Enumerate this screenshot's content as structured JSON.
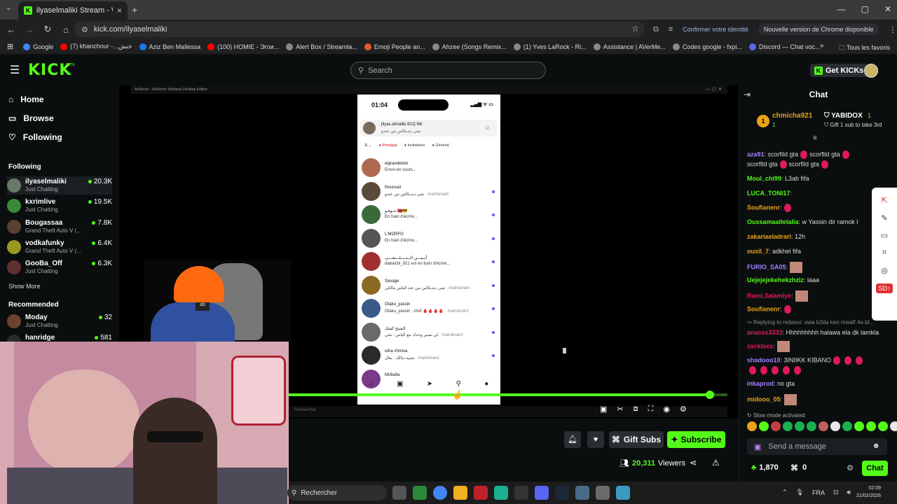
{
  "browser": {
    "tab_title": "ilyaselmaliki Stream - Watch Li...",
    "url": "kick.com/ilyaselmaliki",
    "identity": "Confirmer votre identité",
    "new_version": "Nouvelle version de Chrome disponible",
    "bookmarks": [
      {
        "label": "Google",
        "color": "#4285f4"
      },
      {
        "label": "(7) khanchour -...خنش",
        "color": "#ff0000"
      },
      {
        "label": "Aziz Ben Mallessa",
        "color": "#1877f2"
      },
      {
        "label": "(100) HOMIE - Эгои...",
        "color": "#ff0000"
      },
      {
        "label": "Alert Box / Streamla...",
        "color": "#888888"
      },
      {
        "label": "Emoji People an...",
        "color": "#e8582c"
      },
      {
        "label": "Ahzee (Songs Remix...",
        "color": "#888888"
      },
      {
        "label": "(1) Yves LaRock - Ri...",
        "color": "#888888"
      },
      {
        "label": "Assistance | AVerMe...",
        "color": "#888888"
      },
      {
        "label": "Codes google - fxpi...",
        "color": "#888888"
      },
      {
        "label": "Discord — Chat voc...",
        "color": "#5865f2"
      }
    ],
    "all_bookmarks": "Tous les favoris"
  },
  "kick": {
    "logo": "KICK",
    "beta": "BETA",
    "search_placeholder": "Search",
    "get_kicks": "Get KICKs",
    "brand_color": "#53fc18"
  },
  "sidebar": {
    "nav": [
      {
        "label": "Home",
        "icon": "home-icon"
      },
      {
        "label": "Browse",
        "icon": "browse-icon"
      },
      {
        "label": "Following",
        "icon": "heart-icon"
      }
    ],
    "following_title": "Following",
    "following": [
      {
        "name": "ilyaselmaliki",
        "category": "Just Chatting",
        "viewers": "20.3K",
        "color": "#6a7a6a"
      },
      {
        "name": "kxrimlive",
        "category": "Just Chatting",
        "viewers": "19.5K",
        "color": "#3a8a3a"
      },
      {
        "name": "Bougassaa",
        "category": "Grand Theft Auto V (...",
        "viewers": "7.8K",
        "color": "#5a4030"
      },
      {
        "name": "vodkafunky",
        "category": "Grand Theft Auto V (...",
        "viewers": "6.4K",
        "color": "#9a9a20"
      },
      {
        "name": "GooBa_Off",
        "category": "Just Chatting",
        "viewers": "6.3K",
        "color": "#603030"
      }
    ],
    "show_more": "Show More",
    "recommended_title": "Recommended",
    "recommended": [
      {
        "name": "Moday",
        "category": "Just Chatting",
        "viewers": "32",
        "color": "#704030"
      },
      {
        "name": "hanridge",
        "category": "",
        "viewers": "581",
        "color": "#2a2a2a"
      }
    ]
  },
  "stream": {
    "airserver_title": "AirServer - AirServer Windows Desktop Edition",
    "progress": 0.96,
    "viewers": "20,311",
    "viewers_label": "Viewers",
    "gift_subs": "Gift Subs",
    "subscribe": "Subscribe",
    "inner_search": "Rechercher"
  },
  "phone": {
    "time": "01:04",
    "header_name": "[ilyas.elmaliki.921] Nb'",
    "header_sub": "شي ديدبكاس من عندو",
    "tabs": [
      "Principal",
      "Invitations",
      "Général"
    ],
    "dms": [
      {
        "name": "elgrandetoto",
        "msg": "Envoi en cours...",
        "time": "",
        "color": "#b06a50",
        "dot": false
      },
      {
        "name": "Noussair",
        "msg": "شي ديدبكاس من عندو",
        "time": "· maintenant",
        "color": "#5a4a3a",
        "dot": true
      },
      {
        "name": "خـوفـو 🇲🇦😎",
        "msg": "En train d'écrire...",
        "time": "",
        "color": "#3a6a3a",
        "dot": true
      },
      {
        "name": "L'MORFO",
        "msg": "En train d'écrire...",
        "time": "",
        "color": "#555555",
        "dot": true
      },
      {
        "name": "أيـمـــن الــديـــلـــشـــي",
        "msg": "dabalchi_921 est en train d'écrire...",
        "time": "",
        "color": "#a03030",
        "dot": true
      },
      {
        "name": "Savage",
        "msg": "شي ديدبكاس من عند الياس مالكي",
        "time": "· maintenant",
        "color": "#8a6a20",
        "dot": true
      },
      {
        "name": "Otaku_yassin",
        "msg": "Otaku_yassin : chof 🩸🩸🩸🩸",
        "time": "· maintenant",
        "color": "#3a5a8a",
        "dot": true
      },
      {
        "name": "الشيخ كشك",
        "msg": "لي تسير وحدك مع الياس : شي",
        "time": "· maintenant",
        "color": "#6a6a6a",
        "dot": true
      },
      {
        "name": "ultra chmisa",
        "msg": "شبيه ديالك : بغال",
        "time": "· maintenant",
        "color": "#2a2a2a",
        "dot": true
      },
      {
        "name": "Mc9a9a",
        "msg": "",
        "time": "",
        "color": "#7a3a8a",
        "dot": false
      }
    ]
  },
  "chat": {
    "title": "Chat",
    "gifter_name": "chmicha921",
    "gifter_count": "1",
    "gifter_rank": "1",
    "gifter2_name": "YABIDOX",
    "gifter2_count": "1",
    "gift_note": "Gift 1 sub to take 3rd",
    "messages": [
      {
        "user": "aza91",
        "text": ": scorfild gta",
        "color": "#a080ff",
        "tail": "scorfild gta",
        "line2": "scorfild gta",
        "line2b": "scorfild gta"
      },
      {
        "user": "Moul_chi99",
        "text": ": L3ab fifa",
        "color": "#53fc18"
      },
      {
        "user": "LUCA_TONI17",
        "text": ":",
        "color": "#53fc18"
      },
      {
        "user": "Soufianenr",
        "text": ":",
        "color": "#e8a317"
      },
      {
        "user": "Oussamaaitelalia",
        "text": ": w Yassin dir ramok l",
        "color": "#53fc18"
      },
      {
        "user": "zakariaeladrari",
        "text": ": 12h",
        "color": "#e8a317"
      },
      {
        "user": "ouxil_7",
        "text": ": adkhel fifa",
        "color": "#e8a317"
      },
      {
        "user": "FURIO_SA05",
        "text": ":",
        "color": "#a080ff"
      },
      {
        "user": "Uejejejekehekzhziz",
        "text": ": laaa",
        "color": "#53fc18"
      },
      {
        "user": "RamL3alamiye",
        "text": ":",
        "color": "#e01a5a"
      },
      {
        "user": "Soufianenr",
        "text": ":",
        "color": "#e8a317"
      },
      {
        "user": "anasss3333",
        "text": ": Hhhhhhhhh halawa ela dk lamkla",
        "color": "#e01a5a",
        "reply": "Replying to redaoxi: awa b3da kan mwalf 4a bl..."
      },
      {
        "user": "zacklaxs",
        "text": ":",
        "color": "#e01a5a"
      },
      {
        "user": "shadooo10",
        "text": ": 3INIIKK KIBANO",
        "color": "#a080ff"
      },
      {
        "user": "inkaprod",
        "text": ": no gta",
        "color": "#a080ff"
      },
      {
        "user": "midooo_05",
        "text": ":",
        "color": "#e8a317"
      }
    ],
    "slow_mode": "Slow mode activated",
    "send_placeholder": "Send a message",
    "kicks": "1,870",
    "gifts": "0",
    "chat_button": "Chat",
    "sd_badge": "SD"
  },
  "taskbar": {
    "search": "Rechercher",
    "lang": "FRA",
    "time": "02:09",
    "date": "21/02/2026"
  }
}
